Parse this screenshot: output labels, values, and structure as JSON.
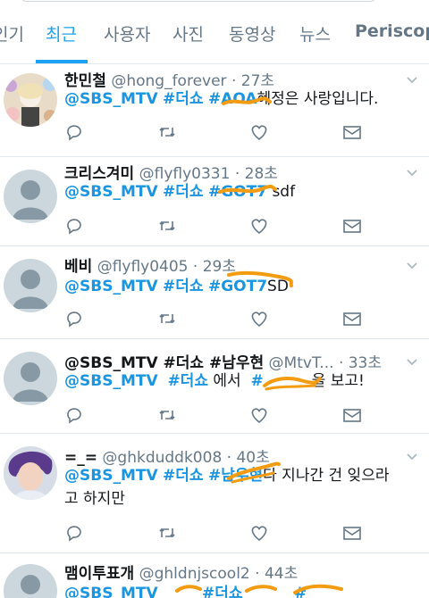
{
  "tabs": [
    {
      "label": "인기"
    },
    {
      "label": "최근",
      "active": true
    },
    {
      "label": "사용자"
    },
    {
      "label": "사진"
    },
    {
      "label": "동영상"
    },
    {
      "label": "뉴스"
    },
    {
      "label": "Periscope"
    }
  ],
  "colors": {
    "accent": "#1da1f2",
    "link": "#1b95e0",
    "redaction": "#f39c12",
    "muted": "#657786"
  },
  "tweets": [
    {
      "name": "한민철",
      "handle": "@hong_forever",
      "time": "· 27초",
      "text": [
        "@SBS_MTV",
        "#더쇼",
        "#AOA",
        "혜정은 사랑입니다."
      ]
    },
    {
      "name": "크리스겨미",
      "handle": "@flyfly0331",
      "time": "· 28초",
      "text": [
        "@SBS_MTV",
        "#더쇼",
        "#GOT7",
        "sdf"
      ]
    },
    {
      "name": "베비",
      "handle": "@flyfly0405",
      "time": "· 29초",
      "text": [
        "@SBS_MTV",
        "#더쇼",
        "#GOT7",
        "SD"
      ]
    },
    {
      "name": "@SBS_MTV  #더쇼  #남우현",
      "handle": "@MtvT...",
      "time": "· 33초",
      "text": [
        "@SBS_MTV",
        "#더쇼",
        "에서",
        "#",
        "을 보고!"
      ]
    },
    {
      "name": "=_=",
      "handle": "@ghkduddk008",
      "time": "· 40초",
      "text": [
        "@SBS_MTV",
        "#더쇼",
        "#남우현",
        "다 지나간 건 잊으라",
        "고 하지만"
      ]
    },
    {
      "name": "맴이투표개",
      "handle": "@ghldnjscool2",
      "time": "· 44초",
      "text": [
        "@SBS_MTV",
        "#더쇼",
        "#"
      ]
    }
  ],
  "icons": [
    "reply-icon",
    "retweet-icon",
    "like-icon",
    "dm-icon",
    "chevron-down-icon"
  ]
}
